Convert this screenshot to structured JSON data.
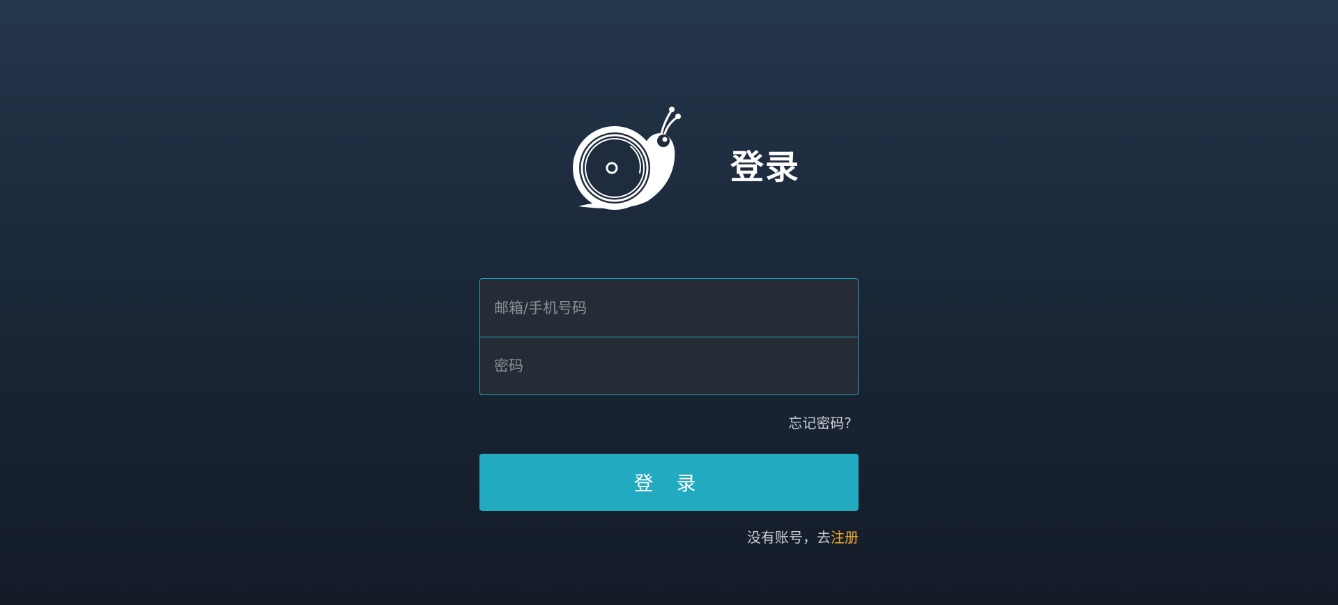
{
  "header": {
    "logo_icon": "snail-logo-icon",
    "title": "登录"
  },
  "form": {
    "account_placeholder": "邮箱/手机号码",
    "account_value": "",
    "password_placeholder": "密码",
    "password_value": "",
    "forgot_password": "忘记密码?",
    "login_button": "登 录",
    "register_prompt": "没有账号，去",
    "register_link": "注册"
  },
  "colors": {
    "accent": "#22aac1",
    "input_border": "#22a3bb",
    "register_link": "#f0a928",
    "background_top": "#25374c",
    "background_bottom": "#141c28"
  }
}
